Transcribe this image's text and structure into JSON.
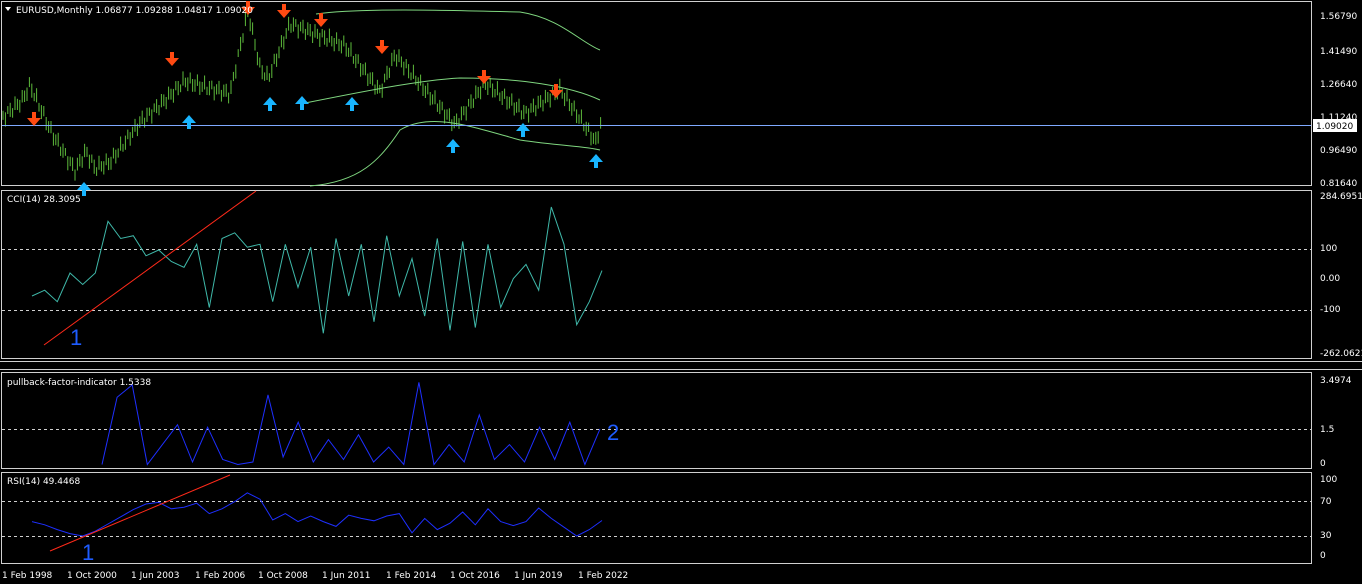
{
  "chart_data": [
    {
      "type": "bar",
      "title": "EURUSD,Monthly  1.06877 1.09288 1.04817 1.09020",
      "ylim": [
        0.78,
        1.62
      ],
      "y_ticks": [
        "1.56790",
        "1.41490",
        "1.26640",
        "1.11240",
        "0.96490",
        "0.81640"
      ],
      "price_label": "1.09020",
      "colors": {
        "bars": "#5dbb3b",
        "bands": "#7fd67f",
        "price_line": "#7fa9ff",
        "down_arrow": "#ff4a12",
        "up_arrow": "#19b5ff"
      },
      "close_path": [
        [
          "1 Feb 1998",
          1.09
        ],
        [
          "Jan 1999",
          1.17
        ],
        [
          "May 1999",
          1.24
        ],
        [
          "Jan 2000",
          1.02
        ],
        [
          "1 Oct 2000",
          0.85
        ],
        [
          "Jan 2001",
          0.94
        ],
        [
          "Jun 2001",
          0.86
        ],
        [
          "Jan 2002",
          0.89
        ],
        [
          "Jan 2003",
          1.07
        ],
        [
          "1 Jun 2003",
          1.15
        ],
        [
          "Jan 2004",
          1.26
        ],
        [
          "1 Feb 2006",
          1.2
        ],
        [
          "Jan 2007",
          1.32
        ],
        [
          "Jul 2008",
          1.58
        ],
        [
          "1 Oct 2008",
          1.27
        ],
        [
          "Mar 2009",
          1.52
        ],
        [
          "1 Jun 2011",
          1.42
        ],
        [
          "Jun 2012",
          1.21
        ],
        [
          "Mar 2014",
          1.38
        ],
        [
          "1 Oct 2016",
          1.06
        ],
        [
          "Jan 2018",
          1.25
        ],
        [
          "1 Jun 2019",
          1.11
        ],
        [
          "Jan 2021",
          1.22
        ],
        [
          "1 Feb 2022",
          0.98
        ],
        [
          "Feb 2023",
          1.09
        ]
      ],
      "upper_band": [
        [
          1.18,
          1.49,
          1.58,
          1.57,
          1.56,
          1.47,
          1.44
        ]
      ],
      "arrows_down": [
        [
          "Jan 1999",
          1.24
        ],
        [
          "Oct 2003",
          1.33
        ],
        [
          "Jul 2008",
          1.6
        ],
        [
          "Mar 2009",
          1.54
        ],
        [
          "1 Jun 2011",
          1.49
        ],
        [
          "Mar 2014",
          1.4
        ],
        [
          "Jan 2018",
          1.25
        ],
        [
          "Jan 2021",
          1.23
        ]
      ],
      "arrows_up": [
        [
          "1 Oct 2000",
          0.83
        ],
        [
          "1 Jun 2003",
          1.12
        ],
        [
          "1 Oct 2008",
          1.24
        ],
        [
          "1 Jun 2011",
          1.24
        ],
        [
          "Jan 2011",
          1.25
        ],
        [
          "1 Oct 2016",
          1.04
        ],
        [
          "1 Jun 2019",
          1.11
        ],
        [
          "1 Feb 2022",
          0.95
        ]
      ]
    },
    {
      "type": "line",
      "title": "CCI(14) 28.3095",
      "ylim": [
        -262.0621,
        284.6951
      ],
      "y_ticks": [
        "284.6951",
        "100",
        "0.00",
        "-100",
        "-262.0621"
      ],
      "levels": [
        100,
        -100
      ],
      "colors": {
        "line": "#3fb8a9",
        "trend": "#ff2a1a"
      },
      "values": [
        -60,
        -40,
        -80,
        20,
        -20,
        20,
        200,
        140,
        150,
        80,
        100,
        60,
        40,
        120,
        -100,
        140,
        160,
        110,
        120,
        -80,
        120,
        -30,
        110,
        -190,
        140,
        -60,
        120,
        -150,
        150,
        -60,
        70,
        -130,
        140,
        -180,
        130,
        -170,
        120,
        -100,
        0,
        50,
        -40,
        250,
        120,
        -160,
        -80,
        28.3
      ],
      "trendline": [
        [
          -262,
          -120
        ],
        [
          300,
          290
        ]
      ],
      "annotation": "1"
    },
    {
      "type": "line",
      "title": "pullback-factor-indicator 1.5338",
      "ylim": [
        0,
        3.4974
      ],
      "y_ticks": [
        "3.4974",
        "1.5",
        "0"
      ],
      "levels": [
        1.5
      ],
      "colors": {
        "line": "#1e2fff"
      },
      "values": [
        0.1,
        2.8,
        3.3,
        0.1,
        0.9,
        1.7,
        0.2,
        1.6,
        0.3,
        0.1,
        0.2,
        2.9,
        0.4,
        1.8,
        0.2,
        1.1,
        0.3,
        1.3,
        0.2,
        0.8,
        0.1,
        3.4,
        0.1,
        0.9,
        0.2,
        2.1,
        0.3,
        0.9,
        0.2,
        1.6,
        0.3,
        1.8,
        0.1,
        1.53
      ],
      "annotation": "2"
    },
    {
      "type": "line",
      "title": "RSI(14) 49.4468",
      "ylim": [
        0,
        100
      ],
      "y_ticks": [
        "100",
        "70",
        "30",
        "0"
      ],
      "levels": [
        70,
        30
      ],
      "colors": {
        "line": "#1e2fff",
        "trend": "#ff2a1a"
      },
      "values": [
        48,
        44,
        38,
        33,
        30,
        36,
        45,
        54,
        63,
        70,
        72,
        64,
        66,
        71,
        58,
        64,
        73,
        84,
        76,
        50,
        58,
        48,
        55,
        48,
        42,
        56,
        52,
        49,
        55,
        58,
        34,
        52,
        38,
        46,
        60,
        44,
        64,
        48,
        43,
        48,
        65,
        52,
        41,
        30,
        38,
        49.4
      ],
      "trendline": [
        [
          0,
          10
        ],
        [
          100,
          82
        ]
      ],
      "annotation": "1"
    }
  ],
  "x_axis": [
    "1 Feb 1998",
    "1 Oct 2000",
    "1 Jun 2003",
    "1 Feb 2006",
    "1 Oct 2008",
    "1 Jun 2011",
    "1 Feb 2014",
    "1 Oct 2016",
    "1 Jun 2019",
    "1 Feb 2022"
  ]
}
